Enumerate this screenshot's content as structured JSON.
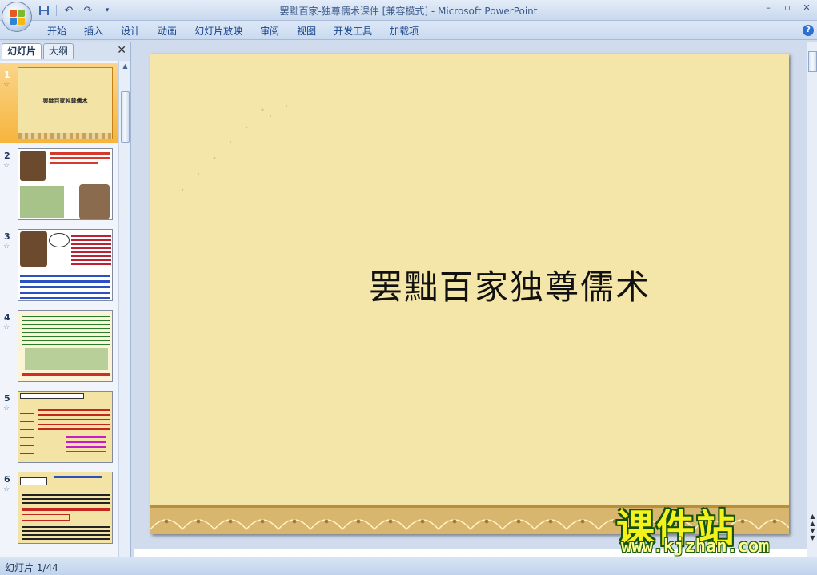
{
  "window": {
    "title": "罢黜百家-独尊儒术课件 [兼容模式] - Microsoft PowerPoint",
    "controls": [
      "minimize-icon",
      "restore-icon",
      "close-icon"
    ]
  },
  "quick_access": [
    "save-icon",
    "undo-icon",
    "redo-icon",
    "customize-icon"
  ],
  "ribbon": {
    "tabs": [
      "开始",
      "插入",
      "设计",
      "动画",
      "幻灯片放映",
      "审阅",
      "视图",
      "开发工具",
      "加载项"
    ],
    "help_label": "?"
  },
  "left_pane": {
    "tabs": [
      "幻灯片",
      "大纲"
    ],
    "close_label": "✕",
    "thumbnails": [
      {
        "number": "1",
        "star": "☆",
        "caption": "罢黜百家独尊儒术"
      },
      {
        "number": "2",
        "star": "☆",
        "caption": ""
      },
      {
        "number": "3",
        "star": "☆",
        "caption": ""
      },
      {
        "number": "4",
        "star": "☆",
        "caption": ""
      },
      {
        "number": "5",
        "star": "☆",
        "caption": ""
      },
      {
        "number": "6",
        "star": "☆",
        "caption": ""
      }
    ]
  },
  "slide": {
    "title": "罢黜百家独尊儒术"
  },
  "status": {
    "slide_counter": "幻灯片 1/44"
  },
  "watermark": {
    "text": "课件站",
    "url": "www.kjzhan.com"
  }
}
